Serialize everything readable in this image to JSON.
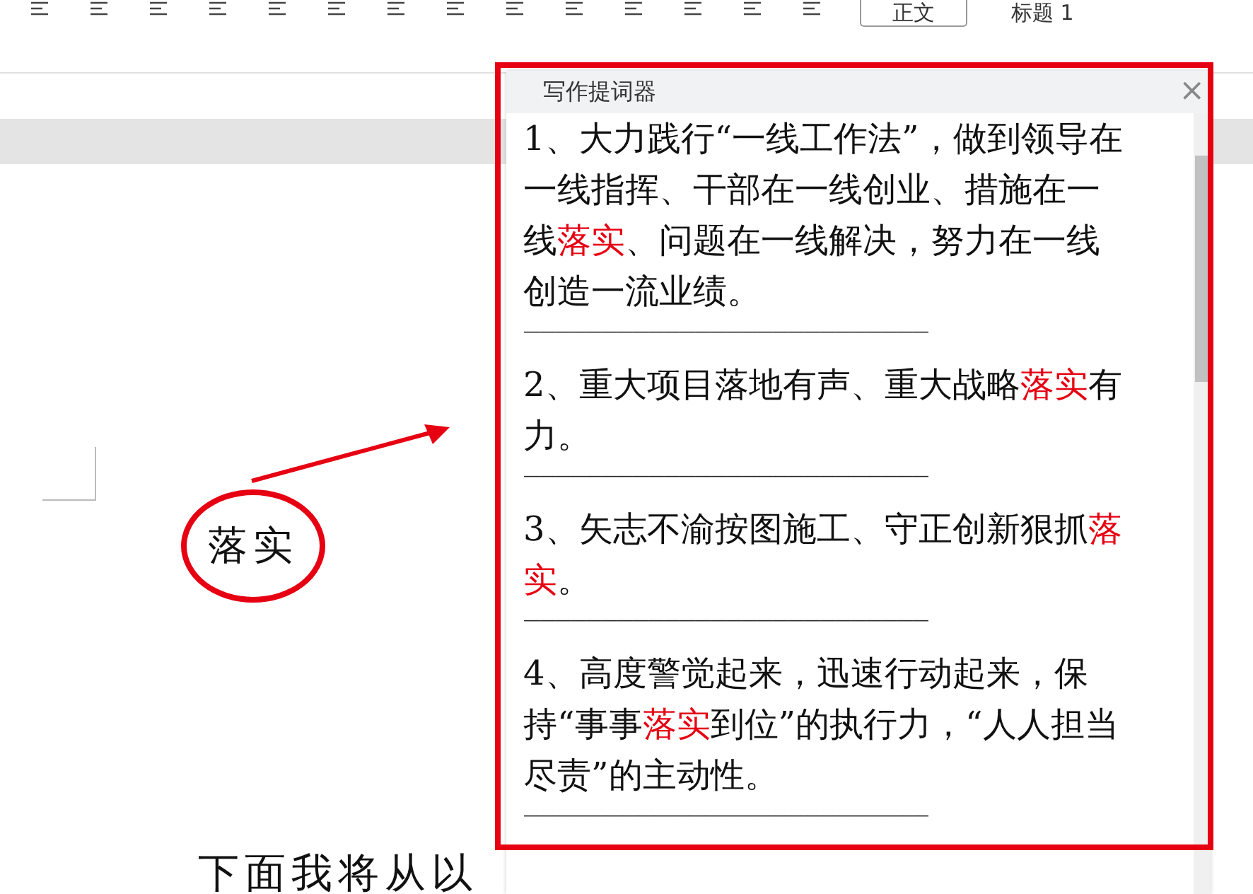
{
  "toolbar": {
    "styles": [
      {
        "label": "正文",
        "selected": true
      },
      {
        "label": "标题 1",
        "selected": false
      }
    ]
  },
  "document": {
    "circled_word": "落实",
    "paragraph_start": "下面我将从以"
  },
  "prompter": {
    "title": "写作提词器",
    "close": "×",
    "separator": "——————————————————————————",
    "items": [
      {
        "segments": [
          {
            "text": "1、大力践行“一线工作法”，做到领导在一线指挥、干部在一线创业、措施在一线",
            "highlight": false
          },
          {
            "text": "落实",
            "highlight": true
          },
          {
            "text": "、问题在一线解决，努力在一线创造一流业绩。",
            "highlight": false
          }
        ]
      },
      {
        "segments": [
          {
            "text": "2、重大项目落地有声、重大战略",
            "highlight": false
          },
          {
            "text": "落实",
            "highlight": true
          },
          {
            "text": "有力。",
            "highlight": false
          }
        ]
      },
      {
        "segments": [
          {
            "text": "3、矢志不渝按图施工、守正创新狠抓",
            "highlight": false
          },
          {
            "text": "落实",
            "highlight": true
          },
          {
            "text": "。",
            "highlight": false
          }
        ]
      },
      {
        "segments": [
          {
            "text": "4、高度警觉起来，迅速行动起来，保持“事事",
            "highlight": false
          },
          {
            "text": "落实",
            "highlight": true
          },
          {
            "text": "到位”的执行力，“人人担当尽责”的主动性。",
            "highlight": false
          }
        ]
      }
    ]
  }
}
